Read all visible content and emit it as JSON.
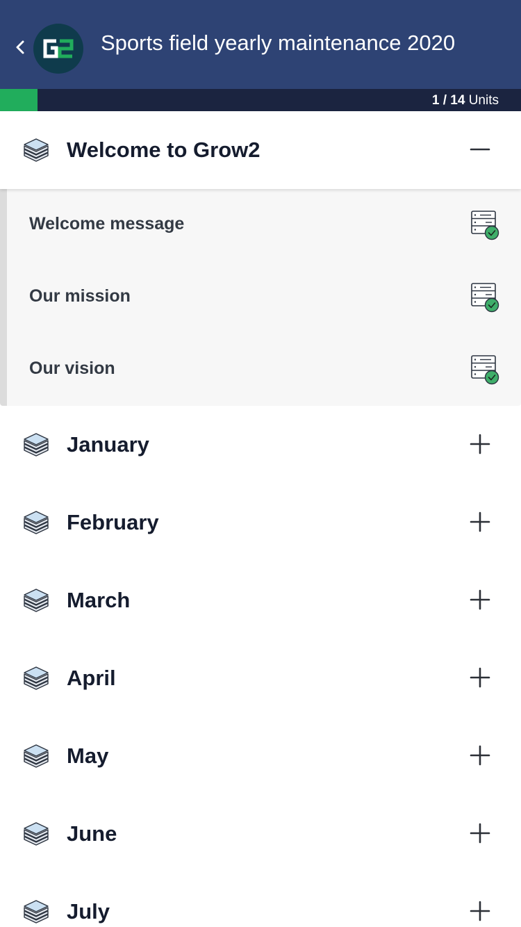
{
  "header": {
    "title": "Sports field yearly maintenance 2020",
    "logo_text": "G2",
    "back_icon": "chevron-left-icon",
    "colors": {
      "background": "#2e4374",
      "logo_bg": "#0f3b4c",
      "logo_accent": "#21ad5c"
    }
  },
  "progress": {
    "current": "1",
    "separator": "/",
    "total": "14",
    "unit_label": "Units",
    "fraction": 0.0714,
    "colors": {
      "fill": "#21ad5c",
      "track": "#1b2440"
    }
  },
  "sections": [
    {
      "title": "Welcome to Grow2",
      "expanded": true,
      "toggle_icon": "minus-icon",
      "lessons": [
        {
          "label": "Welcome message",
          "status_icon": "completed-document-icon"
        },
        {
          "label": "Our mission",
          "status_icon": "completed-document-icon"
        },
        {
          "label": "Our vision",
          "status_icon": "completed-document-icon"
        }
      ]
    },
    {
      "title": "January",
      "expanded": false,
      "toggle_icon": "plus-icon"
    },
    {
      "title": "February",
      "expanded": false,
      "toggle_icon": "plus-icon"
    },
    {
      "title": "March",
      "expanded": false,
      "toggle_icon": "plus-icon"
    },
    {
      "title": "April",
      "expanded": false,
      "toggle_icon": "plus-icon"
    },
    {
      "title": "May",
      "expanded": false,
      "toggle_icon": "plus-icon"
    },
    {
      "title": "June",
      "expanded": false,
      "toggle_icon": "plus-icon"
    },
    {
      "title": "July",
      "expanded": false,
      "toggle_icon": "plus-icon"
    }
  ],
  "colors": {
    "completed_check": "#3fae6a",
    "text_dark": "#151c2e"
  }
}
